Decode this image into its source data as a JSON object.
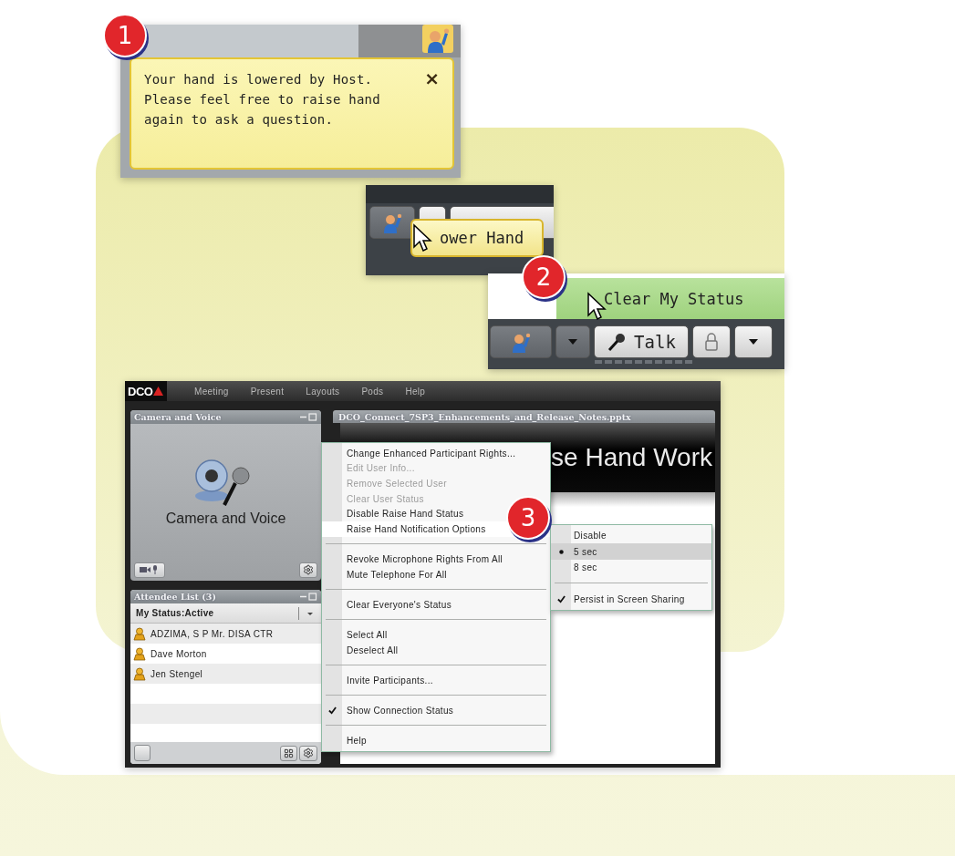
{
  "notification": {
    "step": "1",
    "message": "Your hand is lowered by Host. Please feel free to raise hand again to ask a question.",
    "close": "×"
  },
  "lower_hand": {
    "tooltip": "ower Hand"
  },
  "status_menu": {
    "step": "2",
    "item": "Clear My Status",
    "talk": "Talk"
  },
  "app": {
    "logo": "DCO",
    "menu": [
      "Meeting",
      "Present",
      "Layouts",
      "Pods",
      "Help"
    ],
    "camera_pod": {
      "title": "Camera and Voice",
      "label": "Camera and Voice"
    },
    "attendee_pod": {
      "title": "Attendee List (3)",
      "status": "My Status:Active",
      "attendees": [
        "ADZIMA, S P Mr. DISA CTR",
        "Dave Morton",
        "Jen Stengel"
      ]
    },
    "presentation_pod": {
      "title": "DCO_Connect_7SP3_Enhancements_and_Release_Notes.pptx",
      "slide_title": "se Hand Work"
    },
    "context_menu": {
      "step": "3",
      "items": [
        {
          "kind": "item",
          "label": "Change Enhanced Participant Rights...",
          "disabled": false,
          "checked": false,
          "highlighted": false
        },
        {
          "kind": "item",
          "label": "Edit User Info...",
          "disabled": true,
          "checked": false,
          "highlighted": false
        },
        {
          "kind": "item",
          "label": "Remove Selected User",
          "disabled": true,
          "checked": false,
          "highlighted": false
        },
        {
          "kind": "item",
          "label": "Clear User Status",
          "disabled": true,
          "checked": false,
          "highlighted": false
        },
        {
          "kind": "item",
          "label": "Disable Raise Hand Status",
          "disabled": false,
          "checked": false,
          "highlighted": false
        },
        {
          "kind": "item",
          "label": "Raise Hand Notification Options",
          "disabled": false,
          "checked": false,
          "highlighted": true
        },
        {
          "kind": "separator"
        },
        {
          "kind": "item",
          "label": "Revoke Microphone Rights From All",
          "disabled": false,
          "checked": false,
          "highlighted": false
        },
        {
          "kind": "item",
          "label": "Mute Telephone For All",
          "disabled": false,
          "checked": false,
          "highlighted": false
        },
        {
          "kind": "separator"
        },
        {
          "kind": "item",
          "label": "Clear Everyone's Status",
          "disabled": false,
          "checked": false,
          "highlighted": false
        },
        {
          "kind": "separator"
        },
        {
          "kind": "item",
          "label": "Select All",
          "disabled": false,
          "checked": false,
          "highlighted": false
        },
        {
          "kind": "item",
          "label": "Deselect All",
          "disabled": false,
          "checked": false,
          "highlighted": false
        },
        {
          "kind": "separator"
        },
        {
          "kind": "item",
          "label": "Invite Participants...",
          "disabled": false,
          "checked": false,
          "highlighted": false
        },
        {
          "kind": "separator"
        },
        {
          "kind": "item",
          "label": "Show Connection Status",
          "disabled": false,
          "checked": true,
          "highlighted": false
        },
        {
          "kind": "separator"
        },
        {
          "kind": "item",
          "label": "Help",
          "disabled": false,
          "checked": false,
          "highlighted": false
        }
      ]
    },
    "submenu": {
      "items": [
        {
          "kind": "radio",
          "label": "Disable",
          "selected": false
        },
        {
          "kind": "radio",
          "label": "5 sec",
          "selected": true
        },
        {
          "kind": "radio",
          "label": "8 sec",
          "selected": false
        },
        {
          "kind": "separator"
        },
        {
          "kind": "check",
          "label": "Persist in Screen Sharing",
          "checked": true
        }
      ]
    }
  }
}
